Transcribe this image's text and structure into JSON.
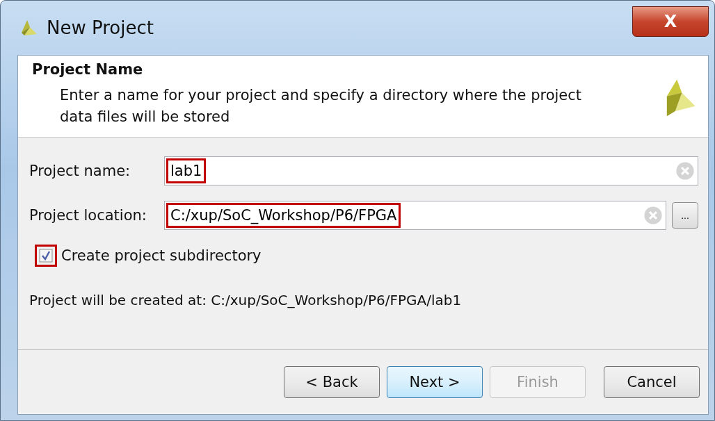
{
  "window": {
    "title": "New Project",
    "close_label": "X"
  },
  "header": {
    "title": "Project Name",
    "description": "Enter a name for your project and specify a directory where the project data files will be stored"
  },
  "fields": [
    {
      "label": "Project name:",
      "value": "lab1",
      "highlighted": true
    },
    {
      "label": "Project location:",
      "value": "C:/xup/SoC_Workshop/P6/FPGA",
      "highlighted": true,
      "browse": "..."
    }
  ],
  "subdirectory": {
    "label": "Create project subdirectory",
    "checked": true,
    "highlighted": true
  },
  "result": "Project will be created at: C:/xup/SoC_Workshop/P6/FPGA/lab1",
  "buttons": [
    {
      "label": "< Back",
      "disabled": false,
      "focused": false
    },
    {
      "label": "Next >",
      "disabled": false,
      "focused": true
    },
    {
      "label": "Finish",
      "disabled": true,
      "focused": false
    },
    {
      "label": "Cancel",
      "disabled": false,
      "focused": false
    }
  ]
}
